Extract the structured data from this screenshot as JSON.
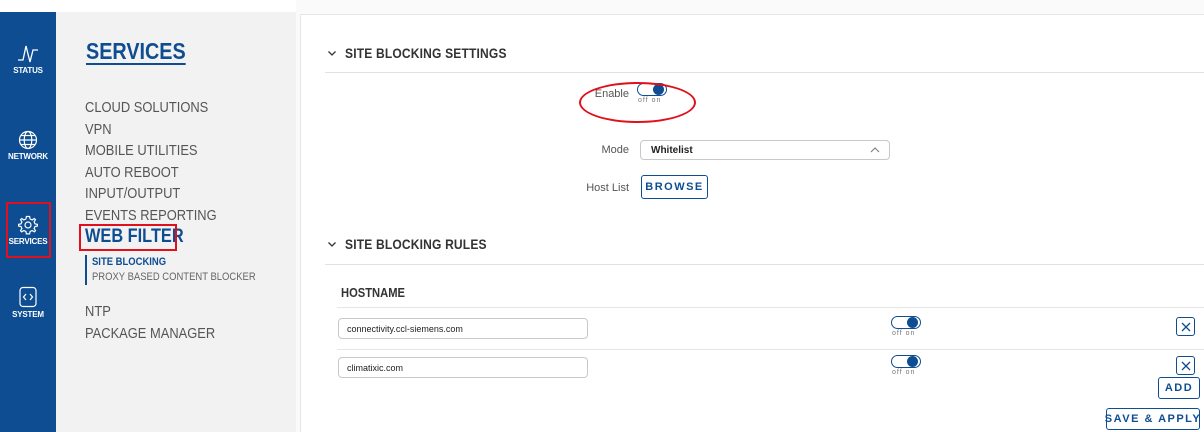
{
  "rail": {
    "items": [
      {
        "label": "STATUS",
        "icon": "pulse-icon"
      },
      {
        "label": "NETWORK",
        "icon": "globe-icon"
      },
      {
        "label": "SERVICES",
        "icon": "gear-icon"
      },
      {
        "label": "SYSTEM",
        "icon": "code-icon"
      }
    ]
  },
  "menu": {
    "title": "SERVICES",
    "items": [
      "CLOUD SOLUTIONS",
      "VPN",
      "MOBILE UTILITIES",
      "AUTO REBOOT",
      "INPUT/OUTPUT",
      "EVENTS REPORTING",
      "WEB FILTER"
    ],
    "submenu": [
      "SITE BLOCKING",
      "PROXY BASED CONTENT BLOCKER"
    ],
    "items_after": [
      "NTP",
      "PACKAGE MANAGER"
    ]
  },
  "settings": {
    "title": "SITE BLOCKING SETTINGS",
    "enable_label": "Enable",
    "enable_on": true,
    "toggle_off": "off",
    "toggle_on": "on",
    "mode_label": "Mode",
    "mode_value": "Whitelist",
    "hostlist_label": "Host List",
    "browse_label": "BROWSE"
  },
  "rules": {
    "title": "SITE BLOCKING RULES",
    "column_header": "HOSTNAME",
    "rows": [
      {
        "hostname": "connectivity.ccl-siemens.com",
        "enabled": true
      },
      {
        "hostname": "climatixic.com",
        "enabled": true
      }
    ],
    "add_label": "ADD",
    "save_label": "SAVE & APPLY"
  },
  "colors": {
    "accent": "#0e4d92",
    "highlight": "#e0101c"
  }
}
